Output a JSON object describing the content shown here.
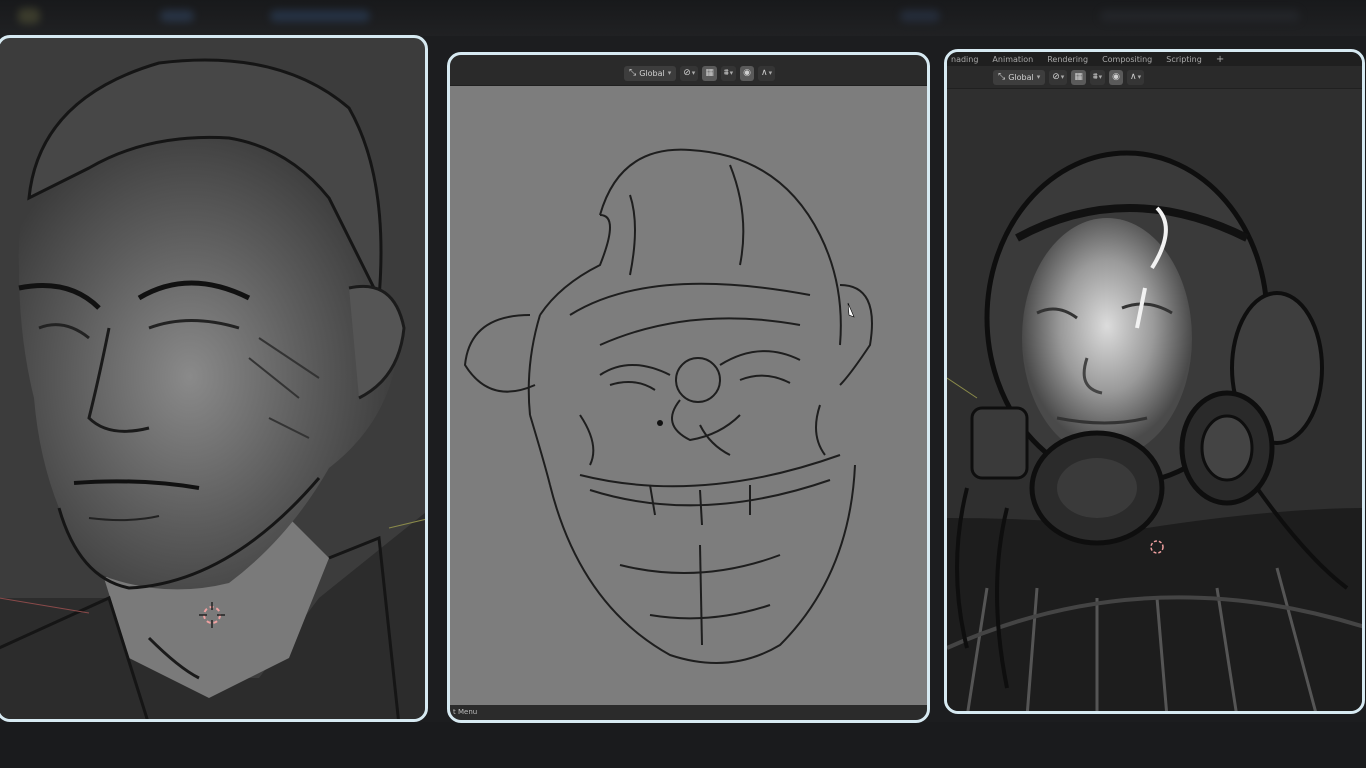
{
  "panels": {
    "middle": {
      "toolbar": {
        "orientation": "Global"
      },
      "status_bar": {
        "text": "t Menu"
      }
    },
    "right": {
      "workspace_tabs": [
        "nading",
        "Animation",
        "Rendering",
        "Compositing",
        "Scripting"
      ],
      "add_tab": "+",
      "toolbar": {
        "orientation": "Global"
      }
    }
  },
  "icons": {
    "orientation": "transform-orientation-icon",
    "pivot": "pivot-icon",
    "snap": "magnet-snap-icon",
    "proportional": "proportional-edit-icon",
    "falloff": "falloff-curve-icon",
    "cursor": "3d-cursor-icon"
  },
  "colors": {
    "panel_border": "#d7eaf2",
    "header": "#2a2a2a",
    "left_bg": "#3c3c3c",
    "mid_bg": "#7d7d7d",
    "right_bg": "#2f2f2f",
    "cursor": "#f0a0a0"
  }
}
